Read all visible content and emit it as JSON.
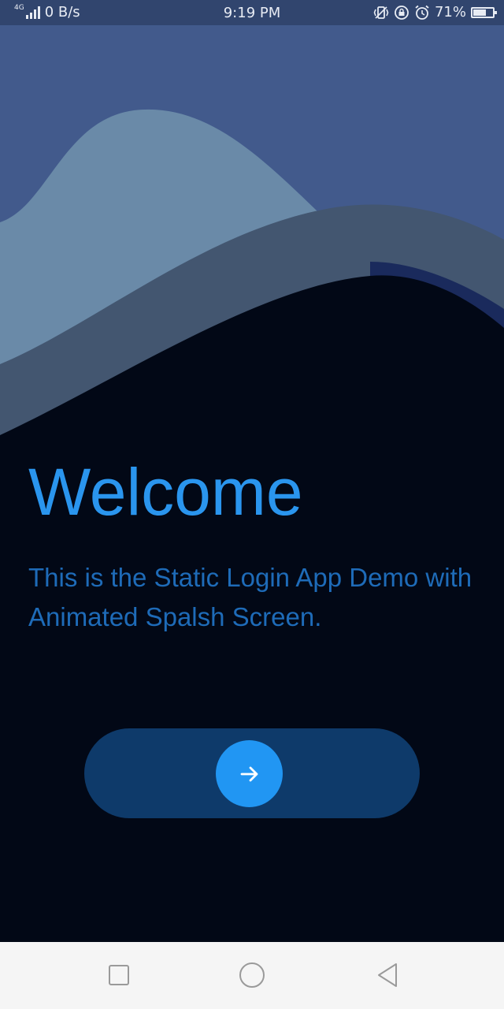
{
  "status_bar": {
    "network_type": "4G",
    "data_speed": "0 B/s",
    "time": "9:19 PM",
    "battery_percent": "71%",
    "battery_level": 0.71,
    "icons": [
      "signal-icon",
      "vibrate-icon",
      "rotation-lock-icon",
      "alarm-icon",
      "battery-icon"
    ]
  },
  "welcome": {
    "title": "Welcome",
    "subtitle": "This is the Static Login App Demo with Animated Spalsh Screen."
  },
  "next_button": {
    "icon": "arrow-right-icon"
  },
  "nav_bar": {
    "items": [
      "recent-apps-icon",
      "home-icon",
      "back-icon"
    ]
  },
  "colors": {
    "background": "#020816",
    "status_bar": "#31456e",
    "title": "#2a95ee",
    "subtitle": "#1e6bb8",
    "button_track": "#0e3a6a",
    "button": "#2196f3",
    "wave_back": "#425a8c",
    "wave_light": "#6a8aa8",
    "wave_mid": "#435670"
  }
}
